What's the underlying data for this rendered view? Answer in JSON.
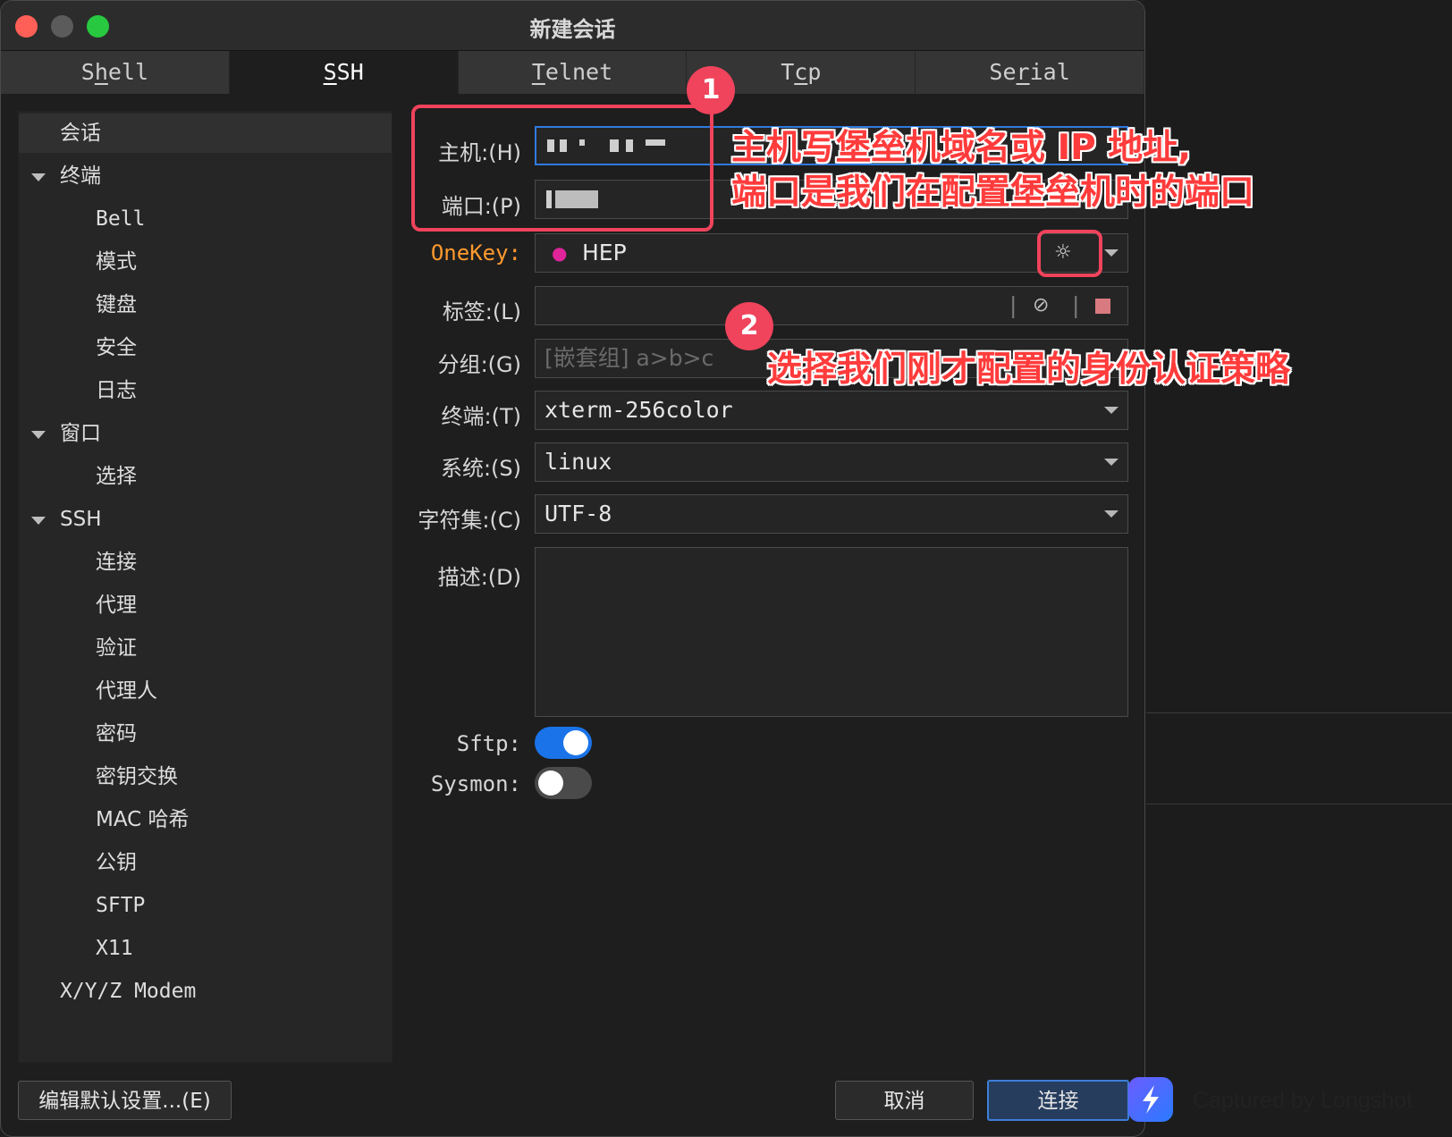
{
  "window": {
    "title": "新建会话"
  },
  "tabs": [
    {
      "label": "Shell",
      "pre": "S",
      "u": "h",
      "post": "ell"
    },
    {
      "label": "SSH",
      "pre": "",
      "u": "S",
      "post": "SH"
    },
    {
      "label": "Telnet",
      "pre": "",
      "u": "T",
      "post": "elnet"
    },
    {
      "label": "Tcp",
      "pre": "T",
      "u": "c",
      "post": "p"
    },
    {
      "label": "Serial",
      "pre": "Se",
      "u": "r",
      "post": "ial"
    }
  ],
  "sidebar": {
    "items": [
      {
        "label": "会话"
      },
      {
        "label": "终端"
      },
      {
        "label": "Bell"
      },
      {
        "label": "模式"
      },
      {
        "label": "键盘"
      },
      {
        "label": "安全"
      },
      {
        "label": "日志"
      },
      {
        "label": "窗口"
      },
      {
        "label": "选择"
      },
      {
        "label": "SSH"
      },
      {
        "label": "连接"
      },
      {
        "label": "代理"
      },
      {
        "label": "验证"
      },
      {
        "label": "代理人"
      },
      {
        "label": "密码"
      },
      {
        "label": "密钥交换"
      },
      {
        "label": "MAC 哈希"
      },
      {
        "label": "公钥"
      },
      {
        "label": "SFTP"
      },
      {
        "label": "X11"
      },
      {
        "label": "X/Y/Z Modem"
      }
    ]
  },
  "form": {
    "host_label": "主机:(H)",
    "port_label": "端口:(P)",
    "onekey_label": "OneKey:",
    "onekey_value": "HEP",
    "tag_label": "标签:(L)",
    "group_label": "分组:(G)",
    "group_placeholder": "[嵌套组] a>b>c",
    "terminal_label": "终端:(T)",
    "terminal_value": "xterm-256color",
    "system_label": "系统:(S)",
    "system_value": "linux",
    "charset_label": "字符集:(C)",
    "charset_value": "UTF-8",
    "desc_label": "描述:(D)",
    "sftp_label": "Sftp:",
    "sftp_on": true,
    "sysmon_label": "Sysmon:",
    "sysmon_on": false
  },
  "buttons": {
    "edit_defaults": "编辑默认设置...(E)",
    "cancel": "取消",
    "connect": "连接"
  },
  "annotations": {
    "badge1": "1",
    "badge2": "2",
    "note1_line1": "主机写堡垒机域名或 IP 地址,",
    "note1_line2": "端口是我们在配置堡垒机时的端口",
    "note2": "选择我们刚才配置的身份认证策略"
  },
  "watermark": "Captured by Longshot",
  "colors": {
    "accent": "#1a73e8",
    "annotation": "#f0435c",
    "onekey_label": "#ff9a2e",
    "onekey_dot": "#e0259b"
  }
}
